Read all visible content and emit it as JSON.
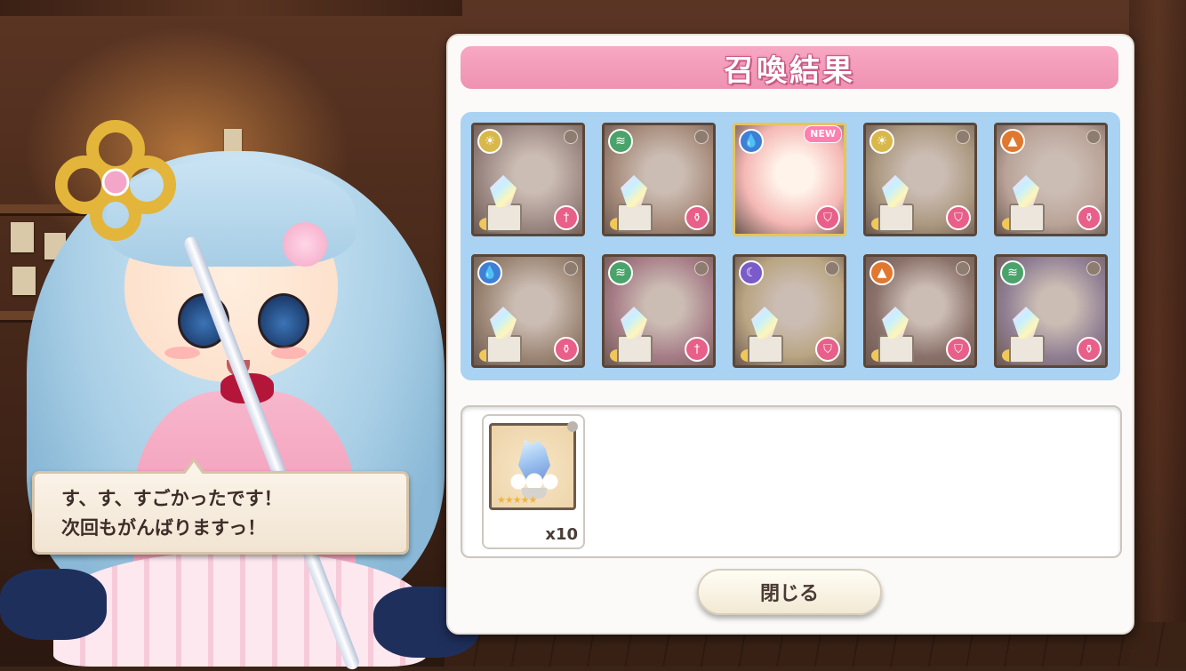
{
  "result_panel": {
    "title": "召喚結果",
    "close_label": "閉じる"
  },
  "dialogue": {
    "line1": "す、す、すごかったです！",
    "line2": "次回もがんばりますっ！"
  },
  "summon_cards": [
    {
      "attribute": "light",
      "attribute_icon": "sun-icon",
      "attribute_color": "#d9b84a",
      "role": "sword-icon",
      "converted": true,
      "is_new": false,
      "tint": "#b9a6a2"
    },
    {
      "attribute": "wind",
      "attribute_icon": "wind-icon",
      "attribute_color": "#4aa36a",
      "role": "potion-icon",
      "converted": true,
      "is_new": false,
      "tint": "#c8a995"
    },
    {
      "attribute": "water",
      "attribute_icon": "water-drop-icon",
      "attribute_color": "#3f7fd6",
      "role": "shield-icon",
      "converted": false,
      "is_new": true,
      "new_label": "NEW",
      "tint": "#f5b8b5"
    },
    {
      "attribute": "light",
      "attribute_icon": "sun-icon",
      "attribute_color": "#d9b84a",
      "role": "shield-icon",
      "converted": true,
      "is_new": false,
      "tint": "#cdbb9a"
    },
    {
      "attribute": "fire",
      "attribute_icon": "fire-icon",
      "attribute_color": "#e0782f",
      "role": "potion-icon",
      "converted": true,
      "is_new": false,
      "tint": "#e3cbbf"
    },
    {
      "attribute": "water",
      "attribute_icon": "water-drop-icon",
      "attribute_color": "#3f7fd6",
      "role": "potion-icon",
      "converted": true,
      "is_new": false,
      "tint": "#b8a28c"
    },
    {
      "attribute": "wind",
      "attribute_icon": "wind-icon",
      "attribute_color": "#4aa36a",
      "role": "sword-icon",
      "converted": true,
      "is_new": false,
      "tint": "#c792a6"
    },
    {
      "attribute": "moon",
      "attribute_icon": "moon-icon",
      "attribute_color": "#7a5bc9",
      "role": "shield-icon",
      "converted": true,
      "is_new": false,
      "tint": "#e3cf9e"
    },
    {
      "attribute": "fire",
      "attribute_icon": "fire-icon",
      "attribute_color": "#e0782f",
      "role": "shield-icon",
      "converted": true,
      "is_new": false,
      "tint": "#9b8079"
    },
    {
      "attribute": "wind",
      "attribute_icon": "wind-icon",
      "attribute_color": "#4aa36a",
      "role": "potion-icon",
      "converted": true,
      "is_new": false,
      "tint": "#a495b8"
    }
  ],
  "rewards": [
    {
      "icon": "crystal-flower-icon",
      "rarity_stars": 5,
      "count": "x10"
    }
  ]
}
